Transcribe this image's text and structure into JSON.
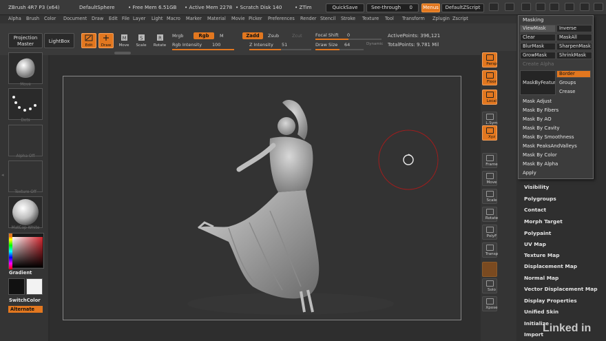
{
  "titlebar": {
    "app": "ZBrush 4R7 P3 (x64)",
    "tool": "DefaultSphere",
    "free_mem": "• Free Mem 6.51GB",
    "active_mem": "• Active Mem 2278",
    "scratch": "• Scratch Disk 140",
    "ztime": "• ZTim",
    "quicksave": "QuickSave",
    "see_through": "See-through",
    "see_through_value": "0",
    "menus": "Menus",
    "script": "DefaultZScript"
  },
  "menubar": [
    "Alpha",
    "Brush",
    "Color",
    "Document",
    "Draw",
    "Edit",
    "File",
    "Layer",
    "Light",
    "Macro",
    "Marker",
    "Material",
    "Movie",
    "Picker",
    "Preferences",
    "Render",
    "Stencil",
    "Stroke",
    "Texture",
    "Tool",
    "Transform",
    "Zplugin",
    "Zscript"
  ],
  "toolbar": {
    "projection_master": "Projection Master",
    "lightbox": "LightBox",
    "edit": "Edit",
    "draw": "Draw",
    "move": "Move",
    "scale": "Scale",
    "rotate": "Rotate",
    "mrgb": "Mrgb",
    "rgb": "Rgb",
    "m": "M",
    "rgb_intensity": "Rgb Intensity",
    "rgb_intensity_value": "100",
    "zadd": "Zadd",
    "zsub": "Zsub",
    "zcut": "Zcut",
    "z_intensity": "Z Intensity",
    "z_intensity_value": "51",
    "focal_shift": "Focal Shift",
    "focal_shift_value": "0",
    "draw_size": "Draw Size",
    "draw_size_value": "64",
    "dynamic": "Dynamic",
    "active_points": "ActivePoints: 396,121",
    "total_points": "TotalPoints: 9.781 Mil",
    "rgb_intensity_level": 1.0,
    "z_intensity_level": 0.51,
    "focal_shift_level": 0.5,
    "draw_size_level": 0.5
  },
  "leftshelf": {
    "brush_label": "Move",
    "stroke_label": "Dots",
    "alpha_label": "Alpha Off",
    "texture_label": "Texture Off",
    "material_label": "MatCap White",
    "gradient": "Gradient",
    "switchcolor": "SwitchColor",
    "alternate": "Alternate"
  },
  "rightshelf": {
    "persp": "Persp",
    "floor": "Floor",
    "local": "Local",
    "lsym": "L.Sym",
    "xyz": "Xyz",
    "frame": "Frame",
    "move": "Move",
    "scale": "Scale",
    "rotate": "Rotate",
    "polyf": "PolyF",
    "transp": "Transp",
    "solo": "Solo",
    "xpose": "Xpose"
  },
  "masking": {
    "title": "Masking",
    "viewmask": "ViewMask",
    "inverse": "Inverse",
    "clear": "Clear",
    "maskall": "MaskAll",
    "blurmask": "BlurMask",
    "sharpenmask": "SharpenMask",
    "growmask": "GrowMask",
    "shrinkmask": "ShrinkMask",
    "create_alpha": "Create Alpha",
    "maskbyfeature": "MaskByFeature",
    "border": "Border",
    "groups": "Groups",
    "crease": "Crease",
    "mask_adjust": "Mask Adjust",
    "by_fibers": "Mask By Fibers",
    "by_ao": "Mask By AO",
    "by_cavity": "Mask By Cavity",
    "by_smoothness": "Mask By Smoothness",
    "peaks_valleys": "Mask PeaksAndValleys",
    "by_color": "Mask By Color",
    "by_alpha": "Mask By Alpha",
    "apply": "Apply"
  },
  "subpalette": [
    "Visibility",
    "Polygroups",
    "Contact",
    "Morph Target",
    "Polypaint",
    "UV Map",
    "Texture Map",
    "Displacement Map",
    "Normal Map",
    "Vector Displacement Map",
    "Display Properties",
    "Unified Skin",
    "Initialize",
    "Import"
  ],
  "watermark": "Linked in",
  "colors": {
    "accent": "#e2771f",
    "panel": "#3a3a3a",
    "canvas": "#2e2e2e"
  }
}
